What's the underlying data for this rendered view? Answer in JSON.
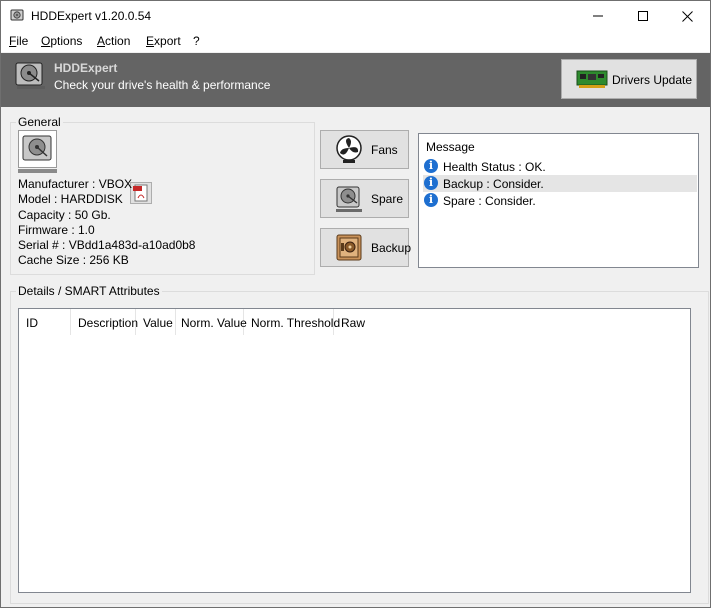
{
  "window": {
    "title": "HDDExpert v1.20.0.54"
  },
  "menu": [
    {
      "key": "F",
      "rest": "ile"
    },
    {
      "key": "O",
      "rest": "ptions"
    },
    {
      "key": "A",
      "rest": "ction"
    },
    {
      "key": "E",
      "rest": "xport"
    },
    {
      "key": "",
      "rest": "?"
    }
  ],
  "banner": {
    "title": "HDDExpert",
    "subtitle": "Check your drive's health & performance",
    "drivers_button": "Drivers Update"
  },
  "general": {
    "label": "General",
    "manufacturer": "Manufacturer : VBOX",
    "model": "Model : HARDDISK",
    "capacity": "Capacity : 50 Gb.",
    "firmware": "Firmware : 1.0",
    "serial": "Serial # : VBdd1a483d-a10ad0b8",
    "cache": "Cache Size : 256 KB"
  },
  "side_buttons": {
    "fans": "Fans",
    "spare": "Spare",
    "backup": "Backup"
  },
  "messages": {
    "header": "Message",
    "items": [
      {
        "text": "Health Status : OK.",
        "selected": false
      },
      {
        "text": "Backup : Consider.",
        "selected": true
      },
      {
        "text": "Spare : Consider.",
        "selected": false
      }
    ]
  },
  "details": {
    "label": "Details / SMART Attributes",
    "columns": [
      "ID",
      "Description",
      "Value",
      "Norm. Value",
      "Norm. Threshold",
      "Raw"
    ]
  },
  "colors": {
    "banner_bg": "#646464",
    "info_icon": "#1e6fd0",
    "selection": "#e5e5e5"
  }
}
